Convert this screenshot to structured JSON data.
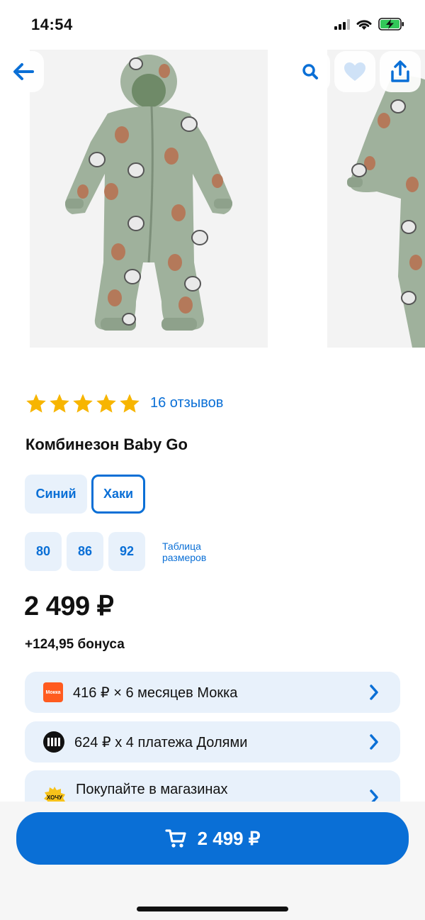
{
  "status_bar": {
    "time": "14:54"
  },
  "product": {
    "reviews_text": "16 отзывов",
    "rating": 5,
    "title": "Комбинезон Baby Go",
    "colors": [
      {
        "label": "Синий",
        "selected": false
      },
      {
        "label": "Хаки",
        "selected": true
      }
    ],
    "sizes": [
      "80",
      "86",
      "92"
    ],
    "size_table_label": "Таблица размеров",
    "price": "2 499 ₽",
    "bonus": "+124,95 бонуса"
  },
  "payments": {
    "mokka": {
      "logo_text": "Мокка",
      "text": "416 ₽ × 6 месяцев Мокка"
    },
    "dolyami": {
      "text": "624 ₽ х 4 платежа Долями"
    },
    "shops": {
      "logo_text": "ХОЧУ",
      "text": "Покупайте в магазинах"
    }
  },
  "buy_button": {
    "price": "2 499 ₽"
  },
  "colors": {
    "accent": "#0a6fd6",
    "chip_bg": "#e8f1fb",
    "star": "#f7b500",
    "fabric": "#9fb19c"
  }
}
